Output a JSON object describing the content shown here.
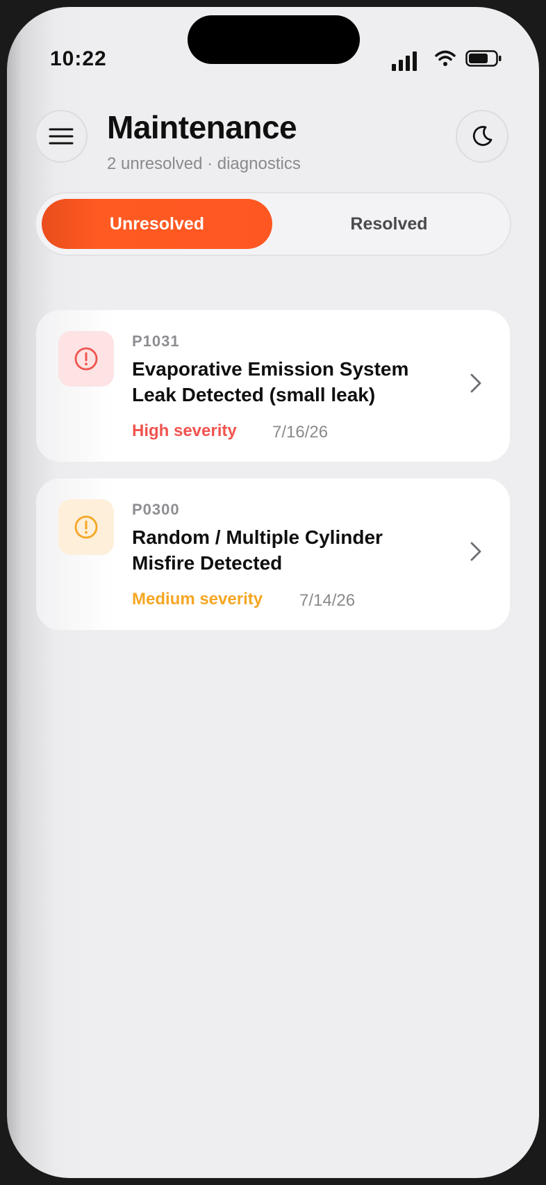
{
  "status_bar": {
    "time": "10:22",
    "icons": [
      "signal-icon",
      "wifi-icon",
      "battery-icon"
    ]
  },
  "header": {
    "title": "Maintenance",
    "subtitle": "2 unresolved · diagnostics",
    "menu_icon": "hamburger-menu-icon",
    "theme_icon": "moon-icon"
  },
  "tabs": [
    {
      "label": "Unresolved",
      "active": true
    },
    {
      "label": "Resolved",
      "active": false
    }
  ],
  "issues": [
    {
      "code": "P1031",
      "title": "Evaporative Emission System Leak Detected (small leak)",
      "severity": "High severity",
      "date": "7/16/26",
      "icon": "alert-circle-icon"
    },
    {
      "code": "P0300",
      "title": "Random / Multiple Cylinder Misfire Detected",
      "severity": "Medium severity",
      "date": "7/14/26",
      "icon": "alert-circle-icon"
    }
  ],
  "colors": {
    "accent": "#ff5722",
    "high_severity": "#f0544f",
    "medium_severity": "#f5a623",
    "high_icon_bg": "#fde3e3",
    "medium_icon_bg": "#fdefd9"
  }
}
